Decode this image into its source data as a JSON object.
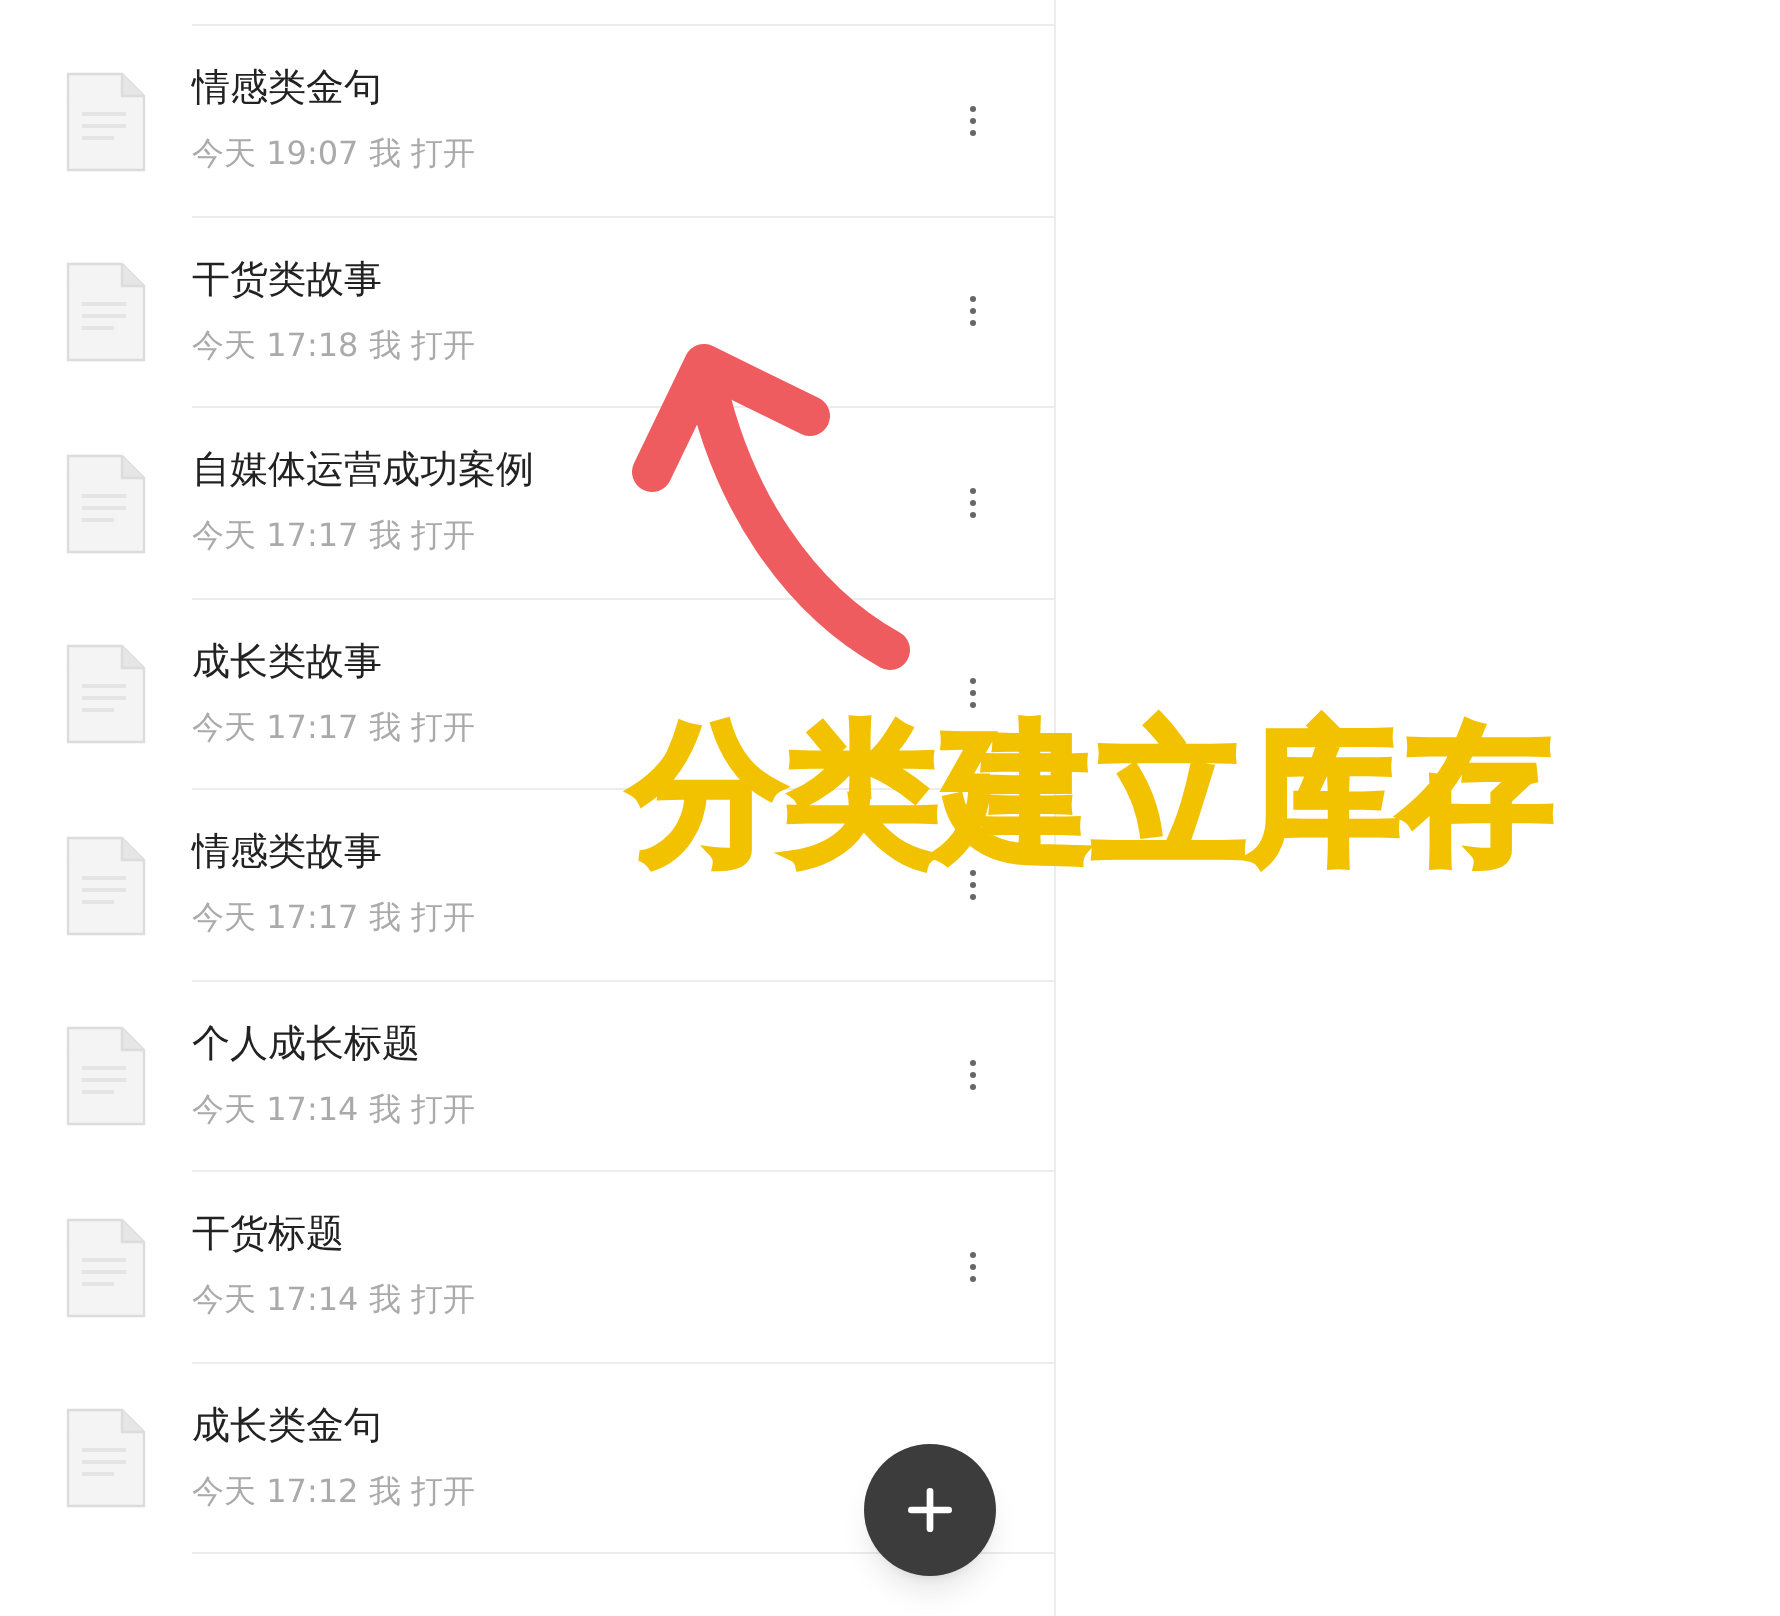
{
  "files": [
    {
      "title": "情感类金句",
      "meta": "今天 19:07 我 打开"
    },
    {
      "title": "干货类故事",
      "meta": "今天 17:18 我 打开"
    },
    {
      "title": "自媒体运营成功案例",
      "meta": "今天 17:17 我 打开"
    },
    {
      "title": "成长类故事",
      "meta": "今天 17:17 我 打开"
    },
    {
      "title": "情感类故事",
      "meta": "今天 17:17 我 打开"
    },
    {
      "title": "个人成长标题",
      "meta": "今天 17:14 我 打开"
    },
    {
      "title": "干货标题",
      "meta": "今天 17:14 我 打开"
    },
    {
      "title": "成长类金句",
      "meta": "今天 17:12 我 打开"
    }
  ],
  "annotation": {
    "text": "分类建立库存"
  }
}
